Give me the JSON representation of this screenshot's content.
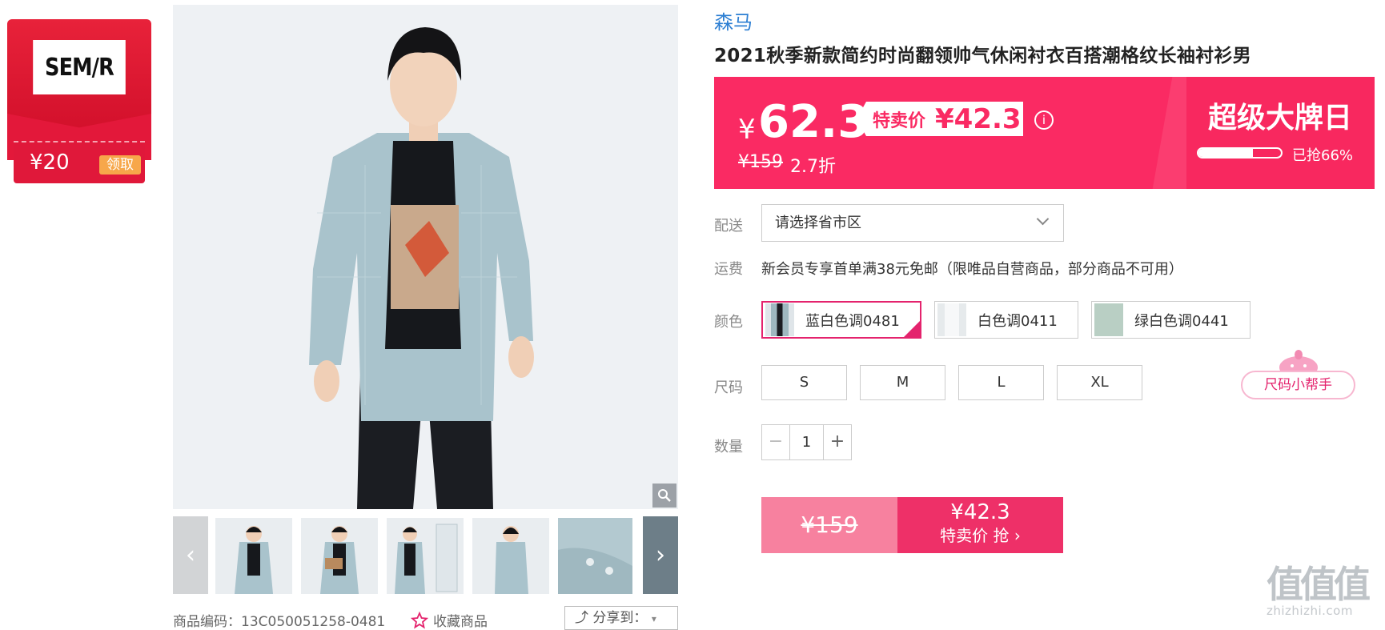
{
  "brand_card": {
    "logo_text": "SEM/R",
    "coupon_amount": "¥20",
    "coupon_button": "领取"
  },
  "gallery": {
    "code_label": "商品编码：13C050051258-0481",
    "favorite_label": "收藏商品",
    "share_label": "分享到："
  },
  "product": {
    "brand": "森马",
    "title": "2021秋季新款简约时尚翻领帅气休闲衬衣百搭潮格纹长袖衬衫男"
  },
  "price": {
    "currency": "¥",
    "current": "62.3",
    "sale_label": "特卖价",
    "sale_price": "¥42.3",
    "info_icon": "i",
    "original": "¥159",
    "discount": "2.7折",
    "event_title": "超级大牌日",
    "sold_percent": 66,
    "sold_text": "已抢66%"
  },
  "delivery": {
    "label": "配送",
    "region_placeholder": "请选择省市区"
  },
  "shipping": {
    "label": "运费",
    "text": "新会员专享首单满38元免邮（限唯品自营商品，部分商品不可用）"
  },
  "colors": {
    "label": "颜色",
    "options": [
      "蓝白色调0481",
      "白色调0411",
      "绿白色调0441"
    ],
    "selected": "蓝白色调0481"
  },
  "sizes": {
    "label": "尺码",
    "options": [
      "S",
      "M",
      "L",
      "XL"
    ],
    "helper": "尺码小帮手"
  },
  "quantity": {
    "label": "数量",
    "minus": "−",
    "value": "1",
    "plus": "+"
  },
  "buy": {
    "original": "¥159",
    "price": "¥42.3",
    "label": "特卖价 抢 ›"
  },
  "watermark": {
    "logo": "值值值",
    "url": "zhizhizhi.com"
  },
  "accent_colors": {
    "banner": "#fa2a63",
    "select": "#e4236d",
    "brand_red": "#e0183a",
    "link": "#2d7fd3"
  }
}
